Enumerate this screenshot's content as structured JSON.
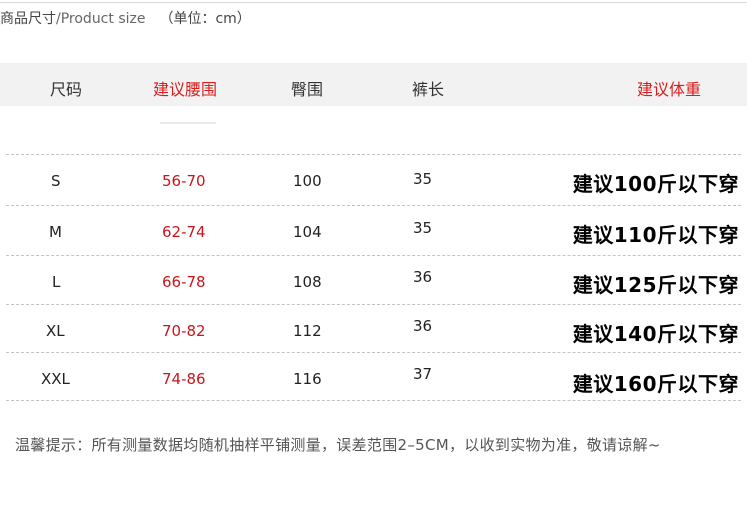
{
  "header": {
    "title_cn": "商品尺寸",
    "title_en": "/Product size",
    "unit": "（单位：cm）"
  },
  "columns": {
    "size": "尺码",
    "waist": "建议腰围",
    "hip": "臀围",
    "length": "裤长",
    "weight": "建议体重"
  },
  "rows": [
    {
      "size": "S",
      "waist": "56-70",
      "hip": "100",
      "length": "35",
      "weight": "建议100斤以下穿"
    },
    {
      "size": "M",
      "waist": "62-74",
      "hip": "104",
      "length": "35",
      "weight": "建议110斤以下穿"
    },
    {
      "size": "L",
      "waist": "66-78",
      "hip": "108",
      "length": "36",
      "weight": "建议125斤以下穿"
    },
    {
      "size": "XL",
      "waist": "70-82",
      "hip": "112",
      "length": "36",
      "weight": "建议140斤以下穿"
    },
    {
      "size": "XXL",
      "waist": "74-86",
      "hip": "116",
      "length": "37",
      "weight": "建议160斤以下穿"
    }
  ],
  "note": "温馨提示：所有测量数据均随机抽样平铺测量，误差范围2–5CM，以收到实物为准，敬请谅解~",
  "colors": {
    "accent_red": "#d81e1e",
    "header_band": "#f2f2f2"
  }
}
